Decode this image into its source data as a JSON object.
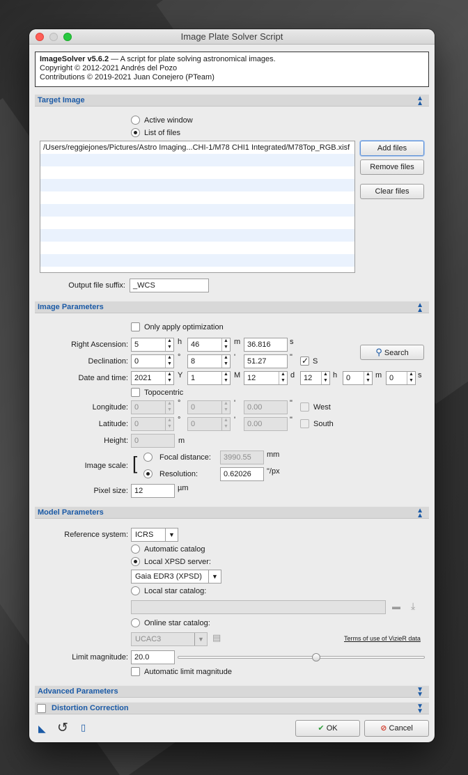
{
  "window": {
    "title": "Image Plate Solver Script"
  },
  "info": {
    "name": "ImageSolver v5.6.2",
    "desc": " — A script for plate solving astronomical images.",
    "copyright1": "Copyright © 2012-2021 Andrés del Pozo",
    "copyright2": "Contributions © 2019-2021 Juan Conejero (PTeam)"
  },
  "target": {
    "section": "Target Image",
    "active_window": "Active window",
    "list_of_files": "List of files",
    "files": [
      "/Users/reggiejones/Pictures/Astro Imaging...CHI-1/M78 CHI1 Integrated/M78Top_RGB.xisf"
    ],
    "add_files": "Add files",
    "remove_files": "Remove files",
    "clear_files": "Clear files",
    "suffix_label": "Output file suffix:",
    "suffix_value": "_WCS"
  },
  "image_params": {
    "section": "Image Parameters",
    "only_opt": "Only apply optimization",
    "ra_label": "Right Ascension:",
    "ra_h": "5",
    "ra_m": "46",
    "ra_s": "36.816",
    "dec_label": "Declination:",
    "dec_d": "0",
    "dec_m": "8",
    "dec_s": "51.27",
    "south_dec": "S",
    "date_label": "Date and time:",
    "date_y": "2021",
    "date_mo": "1",
    "date_d": "12",
    "date_h": "12",
    "date_min": "0",
    "date_s": "0",
    "topocentric": "Topocentric",
    "lon_label": "Longitude:",
    "lon_d": "0",
    "lon_m": "0",
    "lon_s": "0.00",
    "west": "West",
    "lat_label": "Latitude:",
    "lat_d": "0",
    "lat_m": "0",
    "lat_s": "0.00",
    "south": "South",
    "height_label": "Height:",
    "height_value": "0",
    "height_unit": "m",
    "scale_label": "Image scale:",
    "focal_label": "Focal distance:",
    "focal_value": "3990.55",
    "focal_unit": "mm",
    "res_label": "Resolution:",
    "res_value": "0.62026",
    "res_unit": "\"/px",
    "pixel_label": "Pixel size:",
    "pixel_value": "12",
    "pixel_unit": "µm",
    "search": "Search",
    "u_h": "h",
    "u_m": "m",
    "u_s": "s",
    "u_deg": "°",
    "u_min": "'",
    "u_sec": "\"",
    "u_Y": "Y",
    "u_M": "M",
    "u_d": "d"
  },
  "model": {
    "section": "Model Parameters",
    "ref_label": "Reference system:",
    "ref_value": "ICRS",
    "auto_catalog": "Automatic catalog",
    "local_xpsd": "Local XPSD server:",
    "xpsd_value": "Gaia EDR3 (XPSD)",
    "local_star": "Local star catalog:",
    "online_star": "Online star catalog:",
    "online_value": "UCAC3",
    "terms": "Terms of use of VizieR data",
    "limit_label": "Limit magnitude:",
    "limit_value": "20.0",
    "limit_slider": 0.56,
    "auto_limit": "Automatic limit magnitude"
  },
  "advanced": {
    "section": "Advanced Parameters"
  },
  "distortion": {
    "section": "Distortion Correction"
  },
  "footer": {
    "ok": "OK",
    "cancel": "Cancel"
  },
  "colors": {
    "accent": "#1b5aa6",
    "ok_green": "#2e9e3a",
    "cancel_red": "#d23a2a"
  }
}
